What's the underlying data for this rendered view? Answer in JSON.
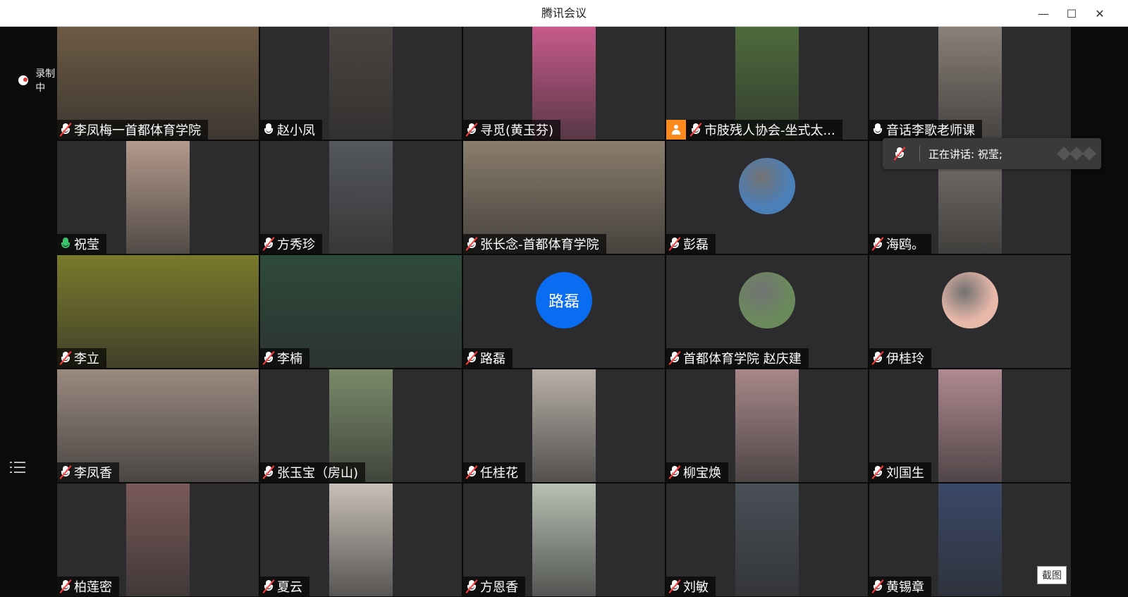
{
  "window": {
    "title": "腾讯会议",
    "controls": {
      "minimize": "—",
      "maximize": "☐",
      "close": "✕"
    }
  },
  "recording": {
    "label": "录制中",
    "icon": "cloud-record-icon"
  },
  "speaking": {
    "label": "正在讲话: 祝莹;"
  },
  "screenshot_button": "截图",
  "participants": [
    {
      "name": "李凤梅一首都体育学院",
      "mic": "muted",
      "kind": "video",
      "wide": true,
      "bg": "#6d5a44"
    },
    {
      "name": "赵小凤",
      "mic": "on-white",
      "kind": "video",
      "bg": "#4a4440"
    },
    {
      "name": "寻觅(黄玉芬)",
      "mic": "muted",
      "kind": "video",
      "bg": "#c85a8c"
    },
    {
      "name": "市肢残人协会-坐式太...",
      "mic": "muted",
      "kind": "video",
      "badge": true,
      "bg": "#4d6b3c"
    },
    {
      "name": "音话李歌老师课",
      "mic": "on-white",
      "kind": "video",
      "bg": "#8a8078"
    },
    {
      "name": "祝莹",
      "mic": "active",
      "kind": "video",
      "bg": "#b49a8c"
    },
    {
      "name": "方秀珍",
      "mic": "muted",
      "kind": "video",
      "bg": "#55585c"
    },
    {
      "name": "张长念-首都体育学院",
      "mic": "muted",
      "kind": "video",
      "wide": true,
      "bg": "#8a7d6c"
    },
    {
      "name": "彭磊",
      "mic": "muted",
      "kind": "avatar",
      "bg": "#4b7fb8"
    },
    {
      "name": "海鸥。",
      "mic": "muted",
      "kind": "video",
      "bg": "#7b746e"
    },
    {
      "name": "李立",
      "mic": "muted",
      "kind": "video",
      "wide": true,
      "bg": "#7a7a2c"
    },
    {
      "name": "李楠",
      "mic": "muted",
      "kind": "video",
      "wide": true,
      "bg": "#2e4a3c"
    },
    {
      "name": "路磊",
      "mic": "muted",
      "kind": "avatar-text",
      "initials": "路磊"
    },
    {
      "name": "首都体育学院 赵庆建",
      "mic": "muted",
      "kind": "avatar",
      "bg": "#6a8a5c"
    },
    {
      "name": "伊桂玲",
      "mic": "muted",
      "kind": "avatar",
      "bg": "#e8b8a8"
    },
    {
      "name": "李凤香",
      "mic": "muted",
      "kind": "video",
      "wide": true,
      "bg": "#9a8a80"
    },
    {
      "name": "张玉宝（房山)",
      "mic": "muted",
      "kind": "video",
      "bg": "#7a8a6a"
    },
    {
      "name": "任桂花",
      "mic": "muted",
      "kind": "video",
      "bg": "#b8b0a8"
    },
    {
      "name": "柳宝焕",
      "mic": "muted",
      "kind": "video",
      "bg": "#a8888a"
    },
    {
      "name": "刘国生",
      "mic": "muted",
      "kind": "video",
      "bg": "#b08a90"
    },
    {
      "name": "柏莲密",
      "mic": "muted",
      "kind": "video",
      "bg": "#7a5a5a"
    },
    {
      "name": "夏云",
      "mic": "muted",
      "kind": "video",
      "bg": "#c8c0b8"
    },
    {
      "name": "方恩香",
      "mic": "muted",
      "kind": "video",
      "bg": "#b8c0b4"
    },
    {
      "name": "刘敏",
      "mic": "muted",
      "kind": "video",
      "bg": "#4a5058"
    },
    {
      "name": "黄锡章",
      "mic": "muted",
      "kind": "video",
      "bg": "#3a4868"
    }
  ]
}
